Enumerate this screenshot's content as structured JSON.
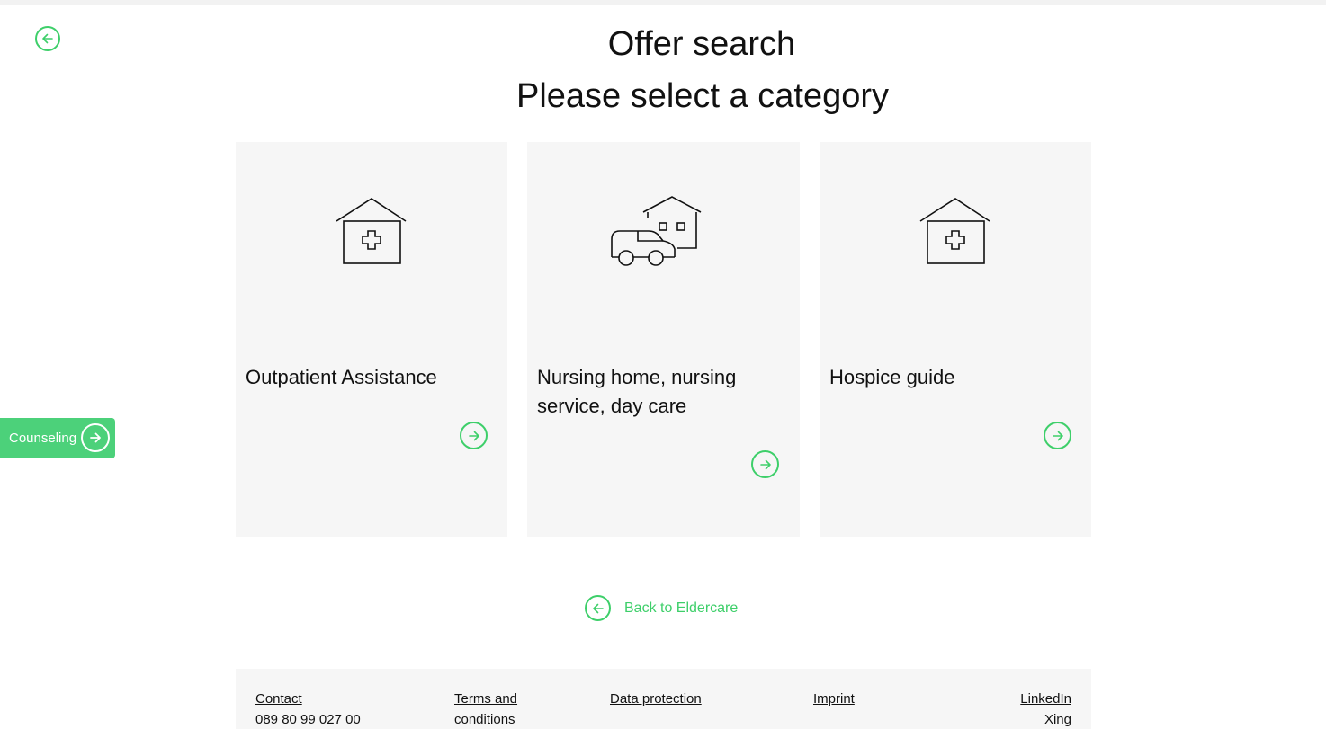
{
  "header": {
    "title": "Offer search",
    "subtitle": "Please select a category"
  },
  "cards": [
    {
      "label": "Outpatient Assistance",
      "icon": "clinic-house-icon"
    },
    {
      "label": "Nursing home, nursing service, day care",
      "icon": "car-and-house-icon"
    },
    {
      "label": "Hospice guide",
      "icon": "clinic-house-icon"
    }
  ],
  "counseling": {
    "label": "Counseling"
  },
  "back_link": {
    "label": "Back to Eldercare"
  },
  "footer": {
    "contact": "Contact",
    "phone": "089 80 99 027 00",
    "terms": "Terms and conditions",
    "data_protection": "Data protection",
    "imprint": "Imprint",
    "linkedin": "LinkedIn",
    "xing": "Xing"
  },
  "colors": {
    "accent": "#3ecf6a",
    "card_bg": "#f6f6f6",
    "counsel_bg": "#4cd17a"
  }
}
